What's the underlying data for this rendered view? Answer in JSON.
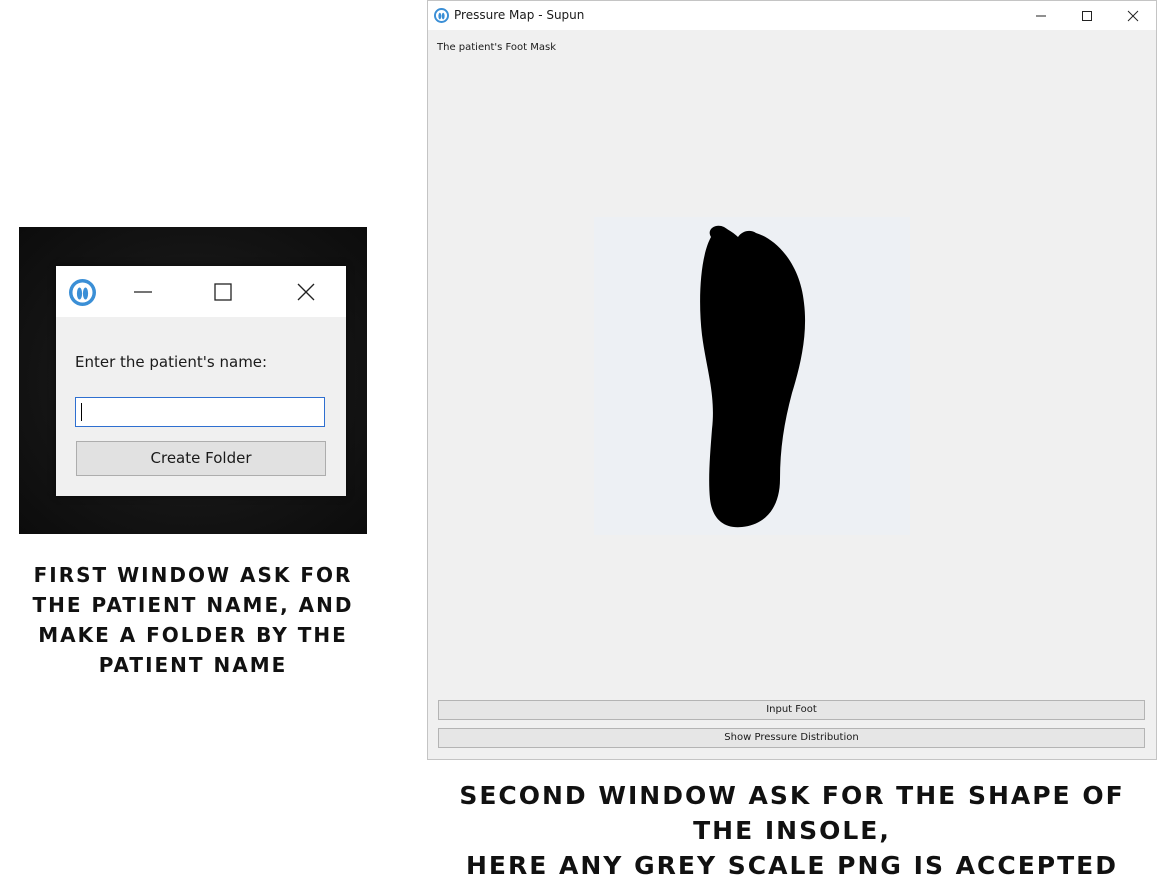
{
  "dialog": {
    "icon": "foot-app-icon",
    "controls": [
      "minimize-icon",
      "maximize-icon",
      "close-icon"
    ],
    "prompt": "Enter the patient's name:",
    "input_value": "",
    "button_label": "Create Folder"
  },
  "caption_first": "FIRST WINDOW ASK FOR THE PATIENT NAME, AND MAKE A FOLDER BY THE PATIENT NAME",
  "main_window": {
    "icon": "foot-app-icon",
    "title": "Pressure Map - Supun",
    "controls": [
      "minimize-icon",
      "maximize-icon",
      "close-icon"
    ],
    "mask_label": "The patient's Foot Mask",
    "buttons": {
      "input_foot": "Input Foot",
      "show_pressure": "Show Pressure Distribution"
    }
  },
  "caption_second": {
    "line1": "SECOND WINDOW ASK FOR THE SHAPE OF THE INSOLE,",
    "line2": "HERE ANY GREY SCALE PNG IS ACCEPTED"
  },
  "colors": {
    "accent_blue": "#3b8fd6",
    "input_border": "#2e6fd0",
    "window_bg": "#f0f0f0",
    "foot_mask": "#000000"
  }
}
